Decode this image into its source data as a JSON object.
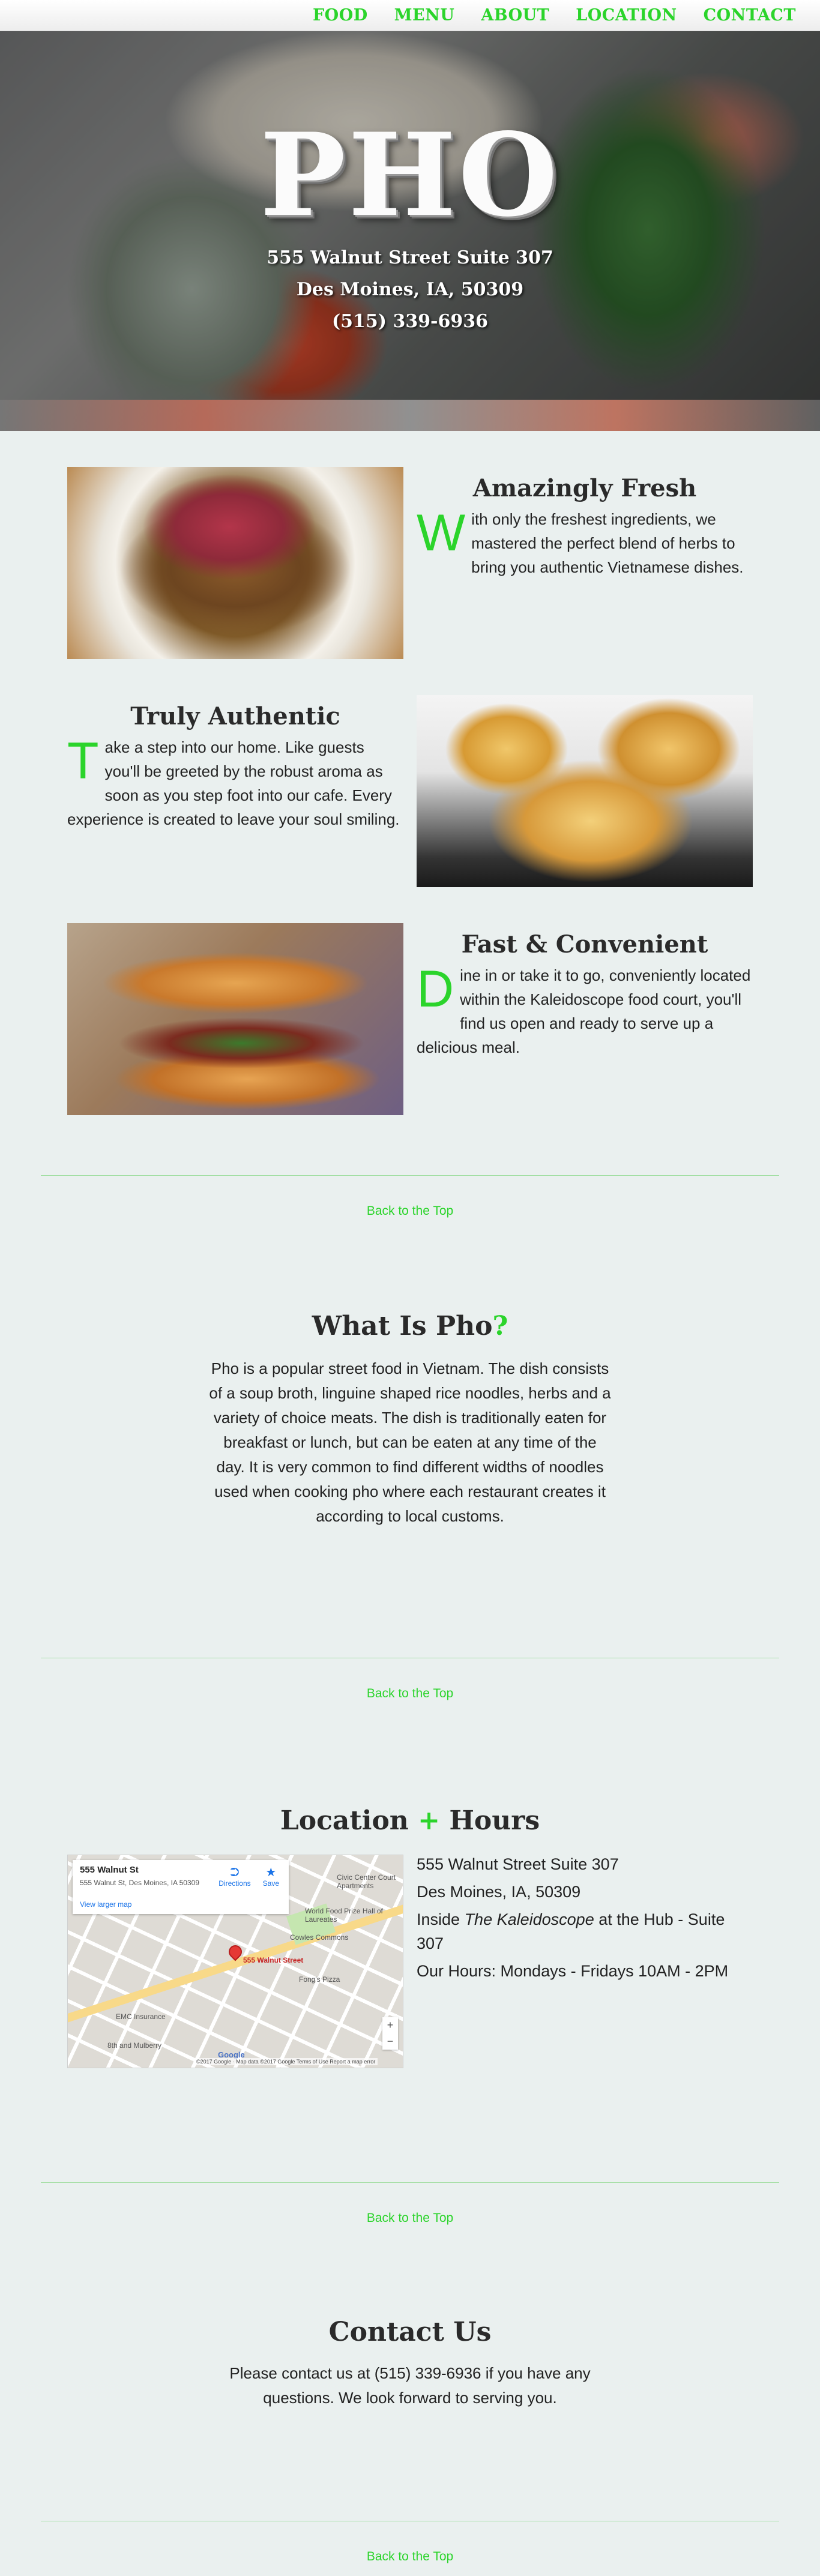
{
  "nav": {
    "items": [
      "FOOD",
      "MENU",
      "ABOUT",
      "LOCATION",
      "CONTACT"
    ]
  },
  "hero": {
    "title": "PHO",
    "address": "555 Walnut Street Suite 307",
    "city": "Des Moines, IA, 50309",
    "phone": "(515) 339-6936"
  },
  "features": [
    {
      "title": "Amazingly Fresh",
      "dropcap": "W",
      "text": "ith only the freshest ingredients, we mastered the perfect blend of herbs to bring you authentic Vietnamese dishes."
    },
    {
      "title": "Truly Authentic",
      "dropcap": "T",
      "text": "ake a step into our home. Like guests you'll be greeted by the robust aroma as soon as you step foot into our cafe. Every experience is created to leave your soul smiling."
    },
    {
      "title": "Fast & Convenient",
      "dropcap": "D",
      "text": "ine in or take it to go, conveniently located within the Kaleidoscope food court, you'll find us open and ready to serve up a delicious meal."
    }
  ],
  "back_to_top": "Back to the Top",
  "about": {
    "title_main": "What Is Pho",
    "title_accent": "?",
    "text": "Pho is a popular street food in Vietnam. The dish consists of a soup broth, linguine shaped rice noodles, herbs and a variety of choice meats. The dish is traditionally eaten for breakfast or lunch, but can be eaten at any time of the day. It is very common to find different widths of noodles used when cooking pho where each restaurant creates it according to local customs."
  },
  "location": {
    "title_left": "Location",
    "title_accent": "+",
    "title_right": "Hours",
    "address": "555 Walnut Street Suite 307",
    "city": "Des Moines, IA, 50309",
    "inside_prefix": "Inside ",
    "inside_name": "The Kaleidoscope",
    "inside_suffix": " at the Hub - Suite 307",
    "hours": "Our Hours: Mondays - Fridays 10AM - 2PM",
    "map": {
      "card_title": "555 Walnut St",
      "card_address": "555 Walnut St, Des Moines, IA 50309",
      "card_link": "View larger map",
      "directions": "Directions",
      "save": "Save",
      "pin_label": "555 Walnut Street",
      "labels": [
        "Civic Center Court Apartments",
        "World Food Prize Hall of Laureates",
        "Cowles Commons",
        "Fong's Pizza",
        "EMC Insurance",
        "8th and Mulberry"
      ],
      "footer": "©2017 Google · Map data ©2017 Google   Terms of Use   Report a map error",
      "google": "Google"
    }
  },
  "contact": {
    "title": "Contact Us",
    "text": "Please contact us at (515) 339-6936 if you have any questions. We look forward to serving you."
  }
}
